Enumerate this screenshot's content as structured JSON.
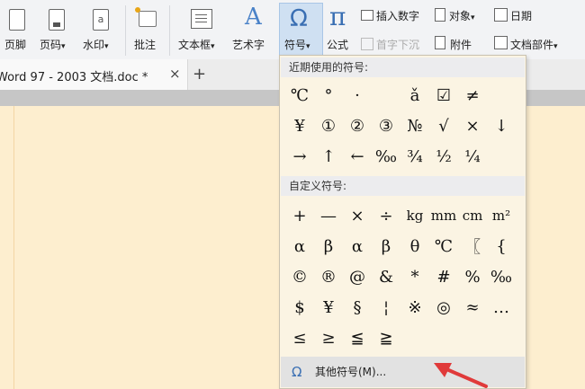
{
  "ribbon": {
    "page_footer": "页脚",
    "page_number": "页码",
    "watermark": "水印",
    "comment": "批注",
    "textbox": "文本框",
    "wordart": "艺术字",
    "symbol": "符号",
    "formula": "公式",
    "drop_cap": "首字下沉",
    "insert_number": "插入数字",
    "object": "对象",
    "date": "日期",
    "attachment": "附件",
    "doc_parts": "文档部件",
    "dropdown_arrow": "▾",
    "pi_glyph": "π",
    "omega_glyph": "Ω",
    "wordart_glyph": "A"
  },
  "tabs": {
    "doc_title": "Word 97 - 2003 文档.doc *",
    "close": "×",
    "add": "+"
  },
  "symbol_panel": {
    "recent_header": "近期使用的符号:",
    "recent_symbols": [
      "℃",
      "°",
      "·",
      "",
      "ǎ",
      "☑",
      "≠",
      "",
      "¥",
      "①",
      "②",
      "③",
      "№",
      "√",
      "×",
      "↓",
      "→",
      "↑",
      "←",
      "‰",
      "¾",
      "½",
      "¼",
      ""
    ],
    "custom_header": "自定义符号:",
    "custom_symbols": [
      "+",
      "—",
      "×",
      "÷",
      "kg",
      "mm",
      "cm",
      "m²",
      "α",
      "β",
      "α",
      "β",
      "θ",
      "℃",
      "〖",
      "{",
      "©",
      "®",
      "@",
      "&",
      "*",
      "#",
      "%",
      "‰",
      "$",
      "¥",
      "§",
      "¦",
      "※",
      "◎",
      "≈",
      "…",
      "≤",
      "≥",
      "≦",
      "≧",
      "",
      "",
      "",
      ""
    ],
    "more_symbols_label": "其他符号(M)...",
    "more_icon_glyph": "Ω"
  },
  "colors": {
    "document_bg": "#fdeecf",
    "ribbon_bg": "#f2f3f5",
    "active_button": "#cfe0f2",
    "annotation_arrow": "#e03a3a"
  }
}
